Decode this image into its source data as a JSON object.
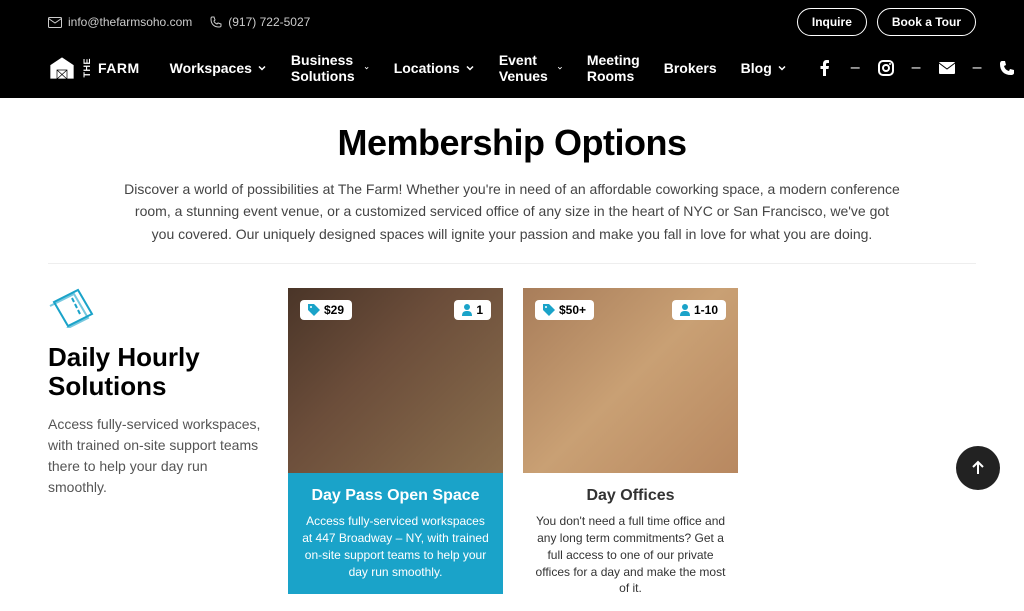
{
  "topbar": {
    "email": "info@thefarmsoho.com",
    "phone": "(917) 722-5027",
    "inquire": "Inquire",
    "book": "Book a Tour"
  },
  "logo": "FARM",
  "nav": {
    "workspaces": "Workspaces",
    "business": "Business Solutions",
    "locations": "Locations",
    "events": "Event Venues",
    "meeting": "Meeting Rooms",
    "brokers": "Brokers",
    "blog": "Blog"
  },
  "page": {
    "title": "Membership Options",
    "intro": "Discover a world of possibilities at The Farm! Whether you're in need of an affordable coworking space, a modern conference room, a stunning event venue, or a customized serviced office of any size in the heart of NYC or San Francisco, we've got you covered. Our uniquely designed spaces will ignite your passion and make you fall in love for what you are doing."
  },
  "section": {
    "title": "Daily Hourly Solutions",
    "desc": "Access fully-serviced workspaces, with trained on-site support teams there to help your day run smoothly."
  },
  "cards": [
    {
      "price": "$29",
      "cap": "1",
      "title": "Day Pass Open Space",
      "desc": "Access fully-serviced workspaces at 447 Broadway – NY, with trained on-site support teams to help your day run smoothly."
    },
    {
      "price": "$50+",
      "cap": "1-10",
      "title": "Day Offices",
      "desc": "You don't need a full time office and any long term commitments? Get a full access to one of our private offices for a day and make the most of it."
    }
  ]
}
